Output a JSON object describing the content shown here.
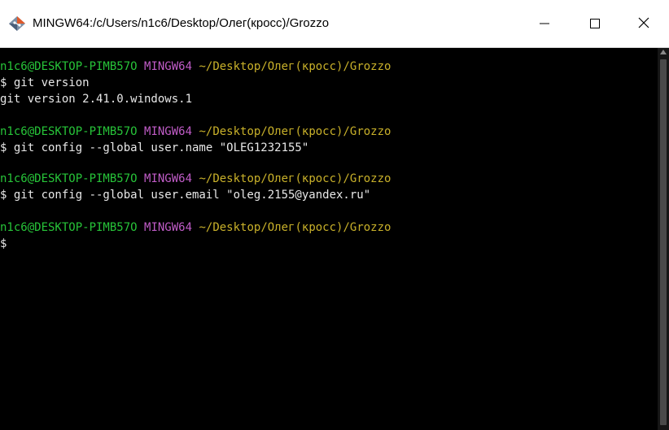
{
  "window": {
    "title": "MINGW64:/c/Users/n1c6/Desktop/Олег(кросс)/Grozzo",
    "app_icon": "git-bash-icon",
    "controls": {
      "minimize_icon": "minimize-icon",
      "maximize_icon": "maximize-icon",
      "close_icon": "close-icon"
    }
  },
  "colors": {
    "background": "#000000",
    "prompt_user": "#27c439",
    "prompt_system": "#c05cc7",
    "prompt_path": "#c9b12a",
    "text": "#e8e8e8"
  },
  "terminal": {
    "blocks": [
      {
        "prompt": {
          "user": "n1c6@DESKTOP-PIMB57O",
          "system": "MINGW64",
          "path": "~/Desktop/Олег(кросс)/Grozzo"
        },
        "command": "$ git version",
        "output": "git version 2.41.0.windows.1"
      },
      {
        "prompt": {
          "user": "n1c6@DESKTOP-PIMB57O",
          "system": "MINGW64",
          "path": "~/Desktop/Олег(кросс)/Grozzo"
        },
        "command": "$ git config --global user.name \"OLEG1232155\""
      },
      {
        "prompt": {
          "user": "n1c6@DESKTOP-PIMB57O",
          "system": "MINGW64",
          "path": "~/Desktop/Олег(кросс)/Grozzo"
        },
        "command": "$ git config --global user.email \"oleg.2155@yandex.ru\""
      },
      {
        "prompt": {
          "user": "n1c6@DESKTOP-PIMB57O",
          "system": "MINGW64",
          "path": "~/Desktop/Олег(кросс)/Grozzo"
        },
        "command": "$"
      }
    ]
  }
}
